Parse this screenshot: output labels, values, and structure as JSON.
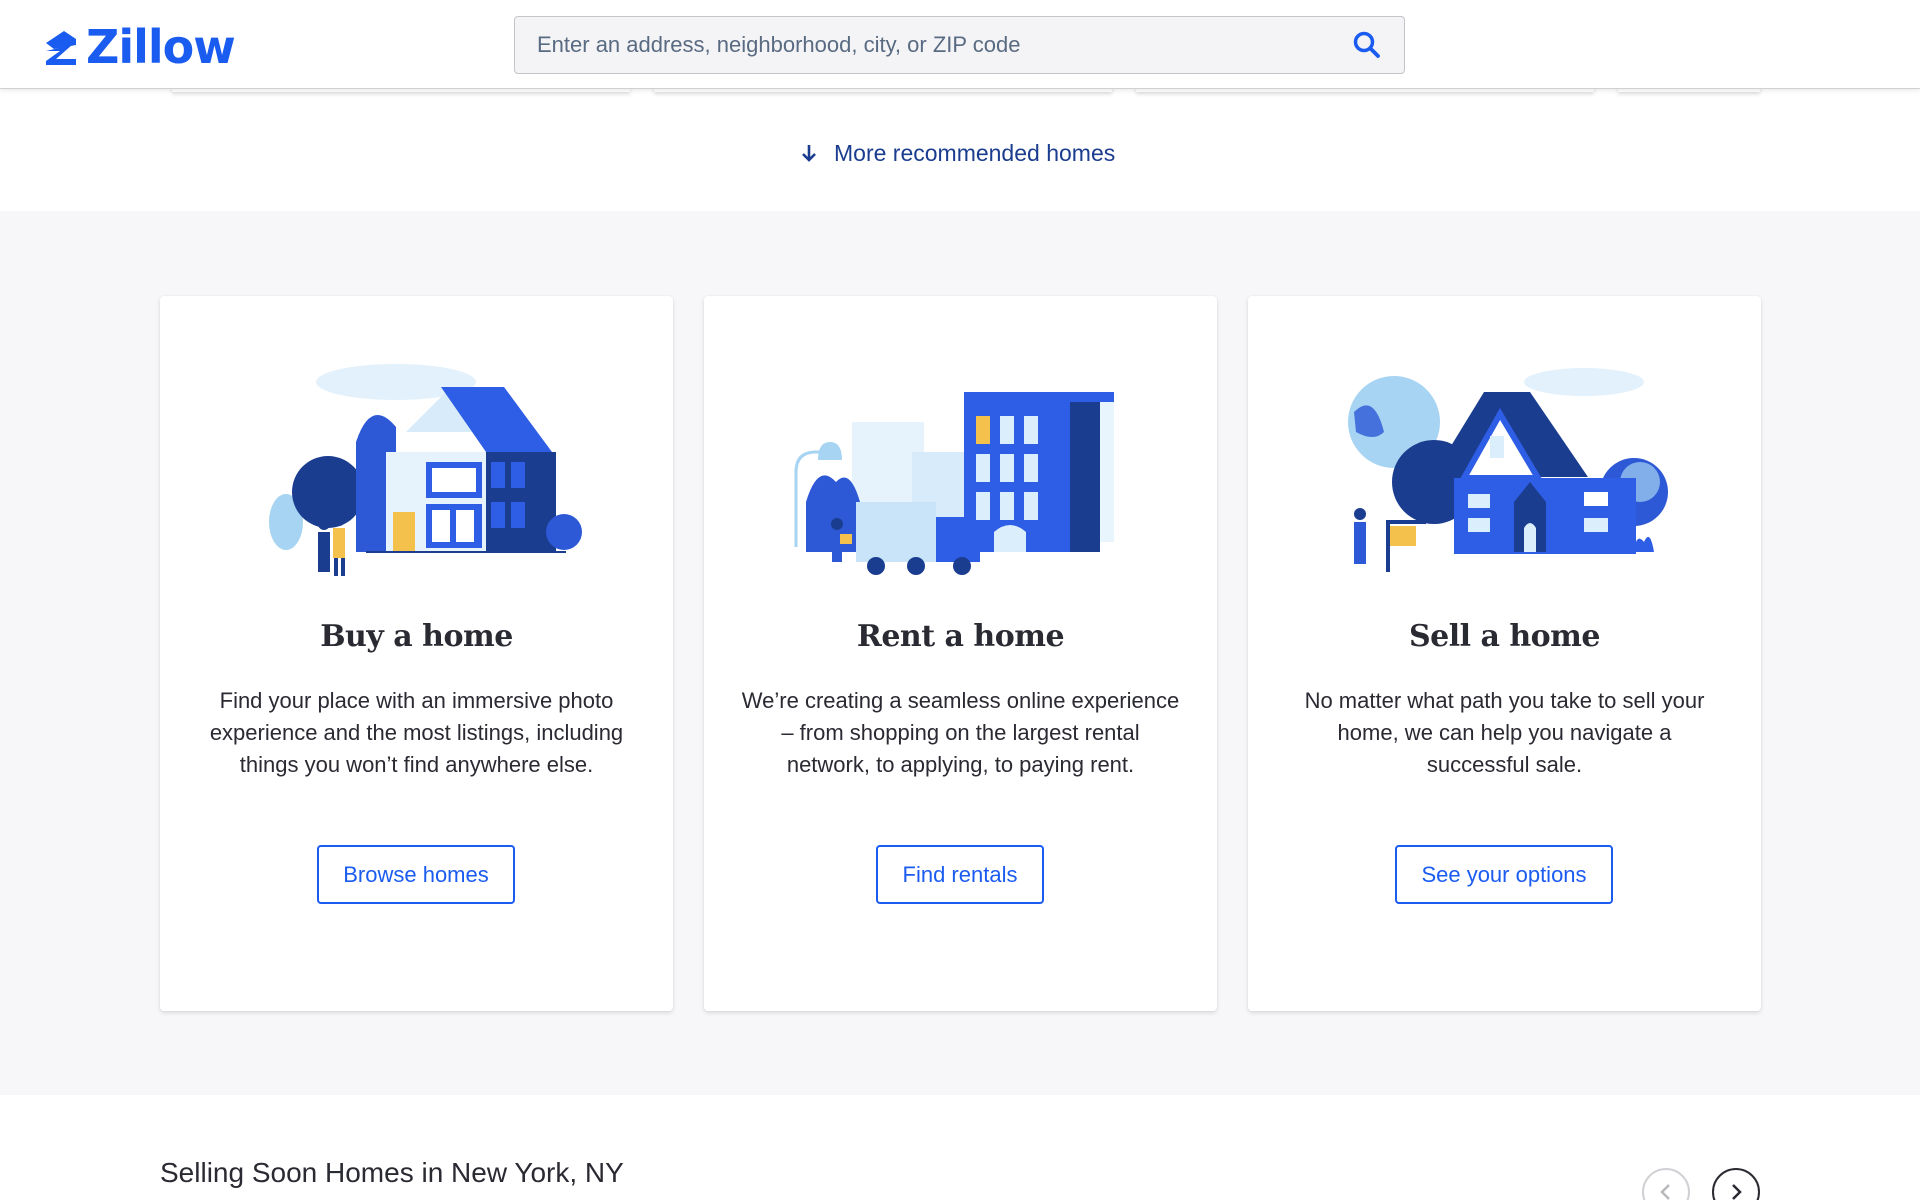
{
  "header": {
    "brand": "Zillow",
    "search_placeholder": "Enter an address, neighborhood, city, or ZIP code"
  },
  "recommended": {
    "more_label": "More recommended homes"
  },
  "cards": [
    {
      "title": "Buy a home",
      "description": "Find your place with an immersive photo experience and the most listings, including things you won’t find anywhere else.",
      "button": "Browse homes",
      "illustration": "house-with-couple-illustration"
    },
    {
      "title": "Rent a home",
      "description": "We’re creating a seamless online experience – from shopping on the largest rental network, to applying, to paying rent.",
      "button": "Find rentals",
      "illustration": "apartment-with-moving-truck-illustration"
    },
    {
      "title": "Sell a home",
      "description": "No matter what path you take to sell your home, we can help you navigate a successful sale.",
      "button": "See your options",
      "illustration": "house-with-sale-sign-illustration"
    }
  ],
  "selling_soon": {
    "title": "Selling Soon Homes in New York, NY"
  },
  "colors": {
    "brand_blue": "#1b5cf0",
    "dark_blue": "#1b3d8f",
    "band_background": "#f7f7f9"
  }
}
